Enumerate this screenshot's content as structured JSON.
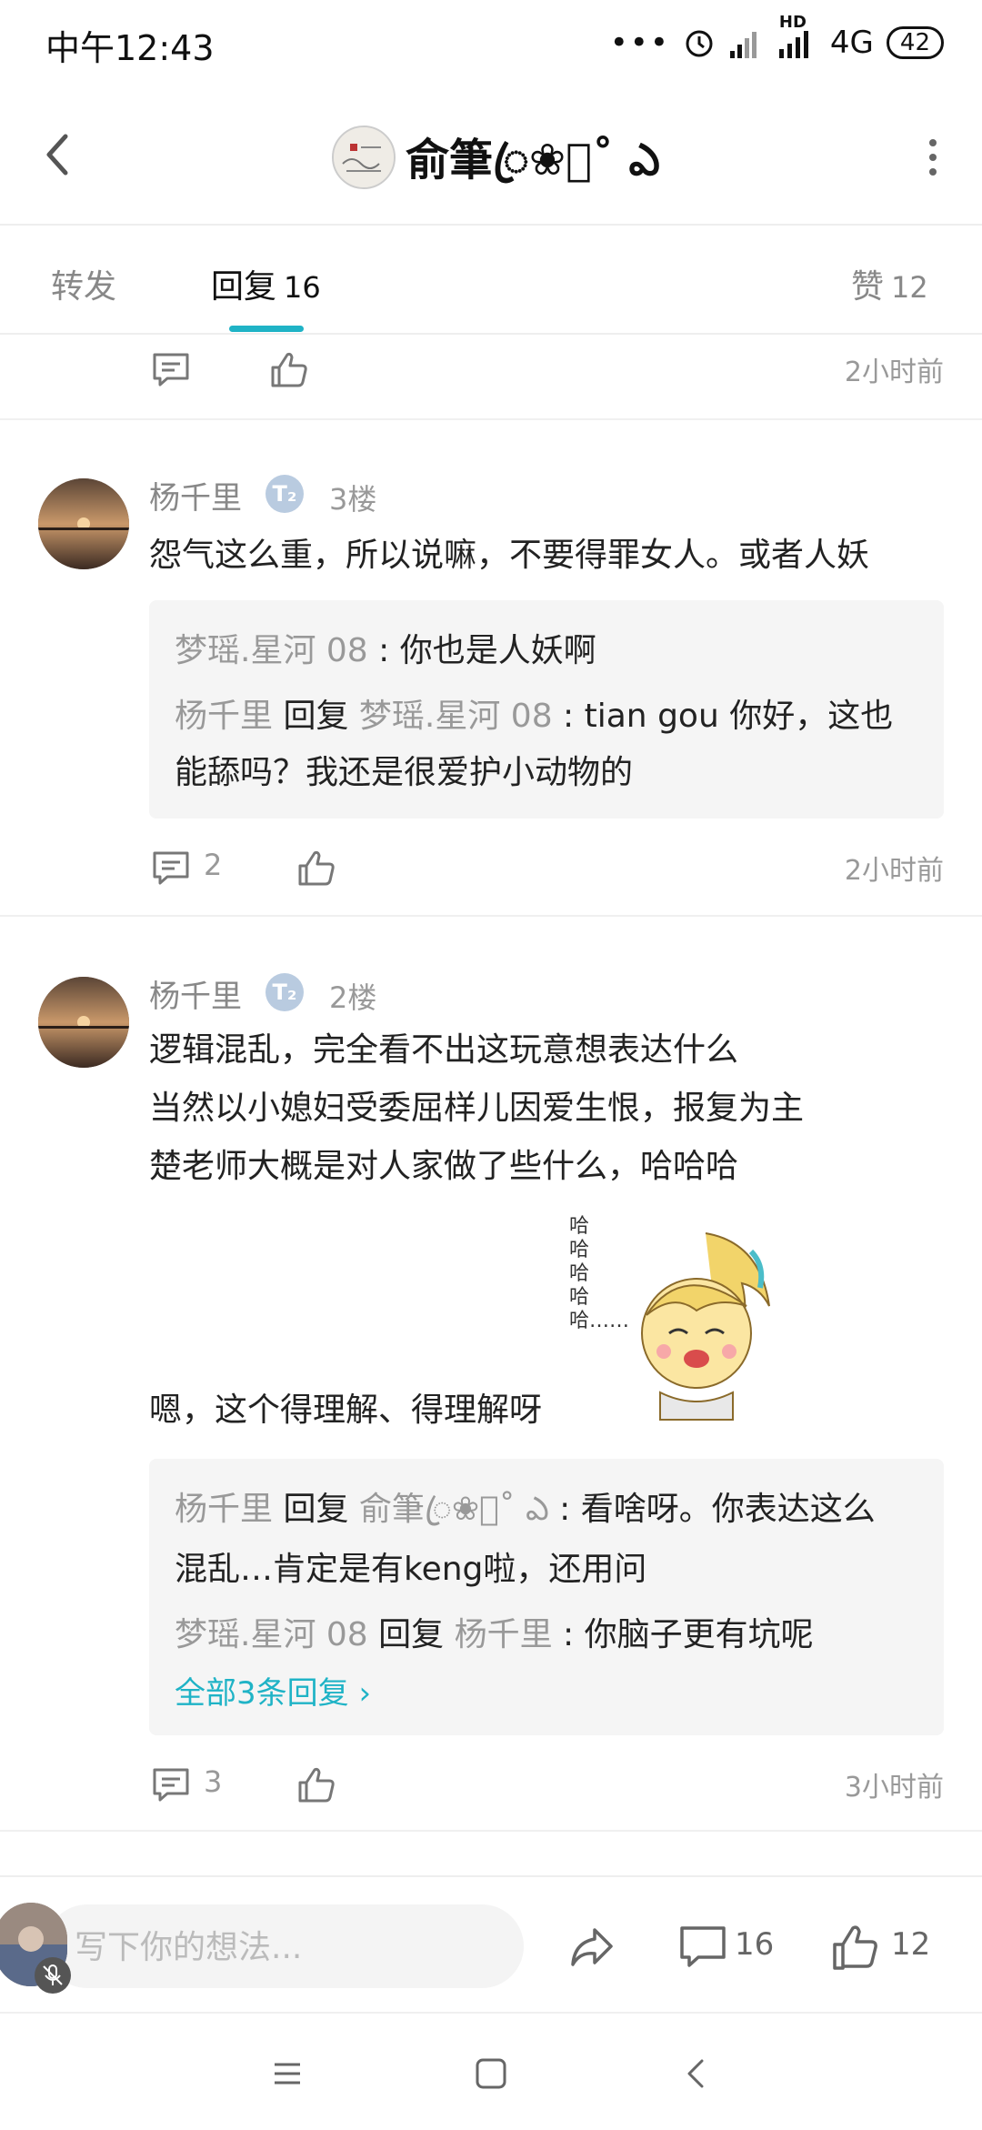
{
  "status": {
    "time": "中午12:43",
    "network": "4G",
    "hd": "HD",
    "battery": "42"
  },
  "header": {
    "title": "俞筆ꦿ❀ꦿ˚ ఎ"
  },
  "tabs": {
    "forward": "转发",
    "reply": "回复",
    "reply_count": "16",
    "like": "赞",
    "like_count": "12"
  },
  "feed": {
    "top_actions": {
      "time": "2小时前"
    },
    "comments": [
      {
        "name": "杨千里",
        "level": "T₂",
        "floor": "3楼",
        "lines": [
          "怨气这么重，所以说嘛，不要得罪女人。或者人妖"
        ],
        "replies": [
          {
            "author": "梦瑶.星河 08",
            "sep": " : ",
            "text": "你也是人妖啊"
          },
          {
            "author": "杨千里",
            "verb": " 回复 ",
            "target": "梦瑶.星河 08",
            "sep": " : ",
            "text1": "tian gou 你好，这也",
            "text2": "能舔吗？我还是很爱护小动物的"
          }
        ],
        "comment_count": "2",
        "time": "2小时前"
      },
      {
        "name": "杨千里",
        "level": "T₂",
        "floor": "2楼",
        "lines": [
          "逻辑混乱，完全看不出这玩意想表达什么",
          "当然以小媳妇受委屈样儿因爱生恨，报复为主",
          "楚老师大概是对人家做了些什么，哈哈哈",
          "嗯，这个得理解、得理解呀"
        ],
        "sticker_text": "哈哈哈哈哈……",
        "replies": [
          {
            "author": "杨千里",
            "verb": " 回复 ",
            "target": "俞筆ꦿ❀ꦿ˚ ఎ",
            "sep": " : ",
            "text1": "看啥呀。你表达这么",
            "text2": "混乱…肯定是有keng啦，还用问"
          },
          {
            "author": "梦瑶.星河 08",
            "verb": " 回复 ",
            "target": "杨千里",
            "sep": " : ",
            "text": "你脑子更有坑呢"
          }
        ],
        "more_replies": "全部3条回复 ›",
        "comment_count": "3",
        "time": "3小时前"
      }
    ]
  },
  "bottom": {
    "placeholder": "写下你的想法...",
    "comment_count": "16",
    "like_count": "12"
  },
  "colors": {
    "accent": "#1fb3c6",
    "muted": "#999999",
    "reply_bg": "#f5f5f5"
  }
}
